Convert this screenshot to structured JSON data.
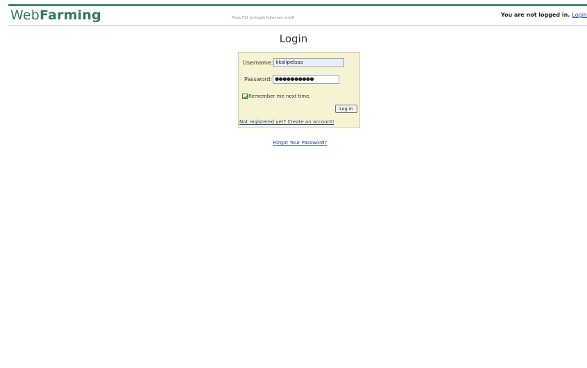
{
  "header": {
    "logo_part1": "Web",
    "logo_part2": "Farming",
    "hint": "Press F11 to toggle fullscreen on/off",
    "auth_status": "You are not logged in.",
    "login_link": "Login"
  },
  "page": {
    "title": "Login"
  },
  "login_form": {
    "username_label": "Username:",
    "username_value": "kkolipetsas",
    "password_label": "Password:",
    "password_value": "●●●●●●●●●●",
    "remember_label": "Remember me next time.",
    "remember_checked": true,
    "submit_label": "Log In",
    "register_link": "Not registered yet? Create an account!"
  },
  "forgot_password_link": "Forgot Your Password?",
  "colors": {
    "brand": "#2f7d58",
    "form_background": "#f6f3d2",
    "link": "#1f3f9a"
  }
}
